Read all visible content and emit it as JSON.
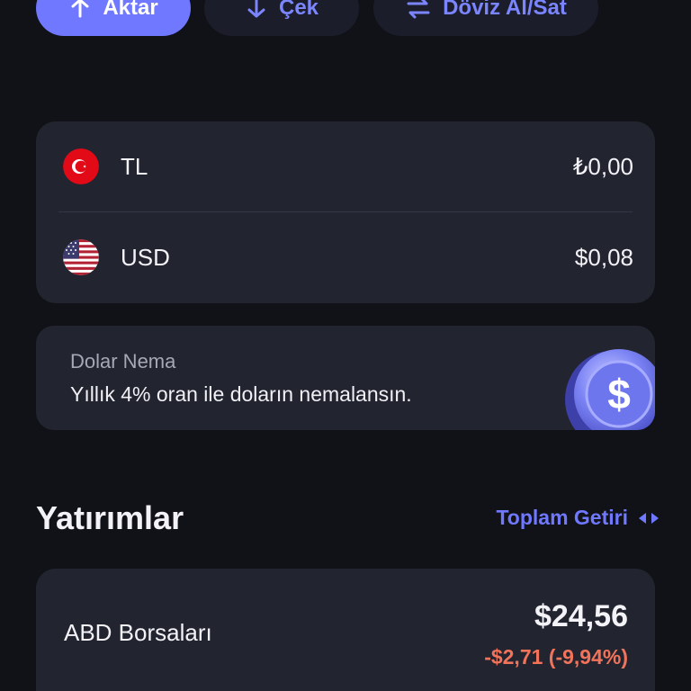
{
  "actions": {
    "aktar_label": "Aktar",
    "cek_label": "Çek",
    "doviz_label": "Döviz Al/Sat"
  },
  "balances": [
    {
      "currency": "TL",
      "amount": "₺0,00",
      "flag_icon": "turkey-flag-icon"
    },
    {
      "currency": "USD",
      "amount": "$0,08",
      "flag_icon": "us-flag-icon"
    }
  ],
  "nema": {
    "title": "Dolar Nema",
    "description": "Yıllık 4% oran ile doların nemalansın."
  },
  "investments": {
    "title": "Yatırımlar",
    "toplam_label": "Toplam Getiri",
    "items": [
      {
        "name": "ABD Borsaları",
        "value": "$24,56",
        "change": "-$2,71 (-9,94%)"
      }
    ]
  },
  "colors": {
    "background": "#111217",
    "card": "#222430",
    "accent": "#6f78ff",
    "negative": "#f0735a"
  }
}
